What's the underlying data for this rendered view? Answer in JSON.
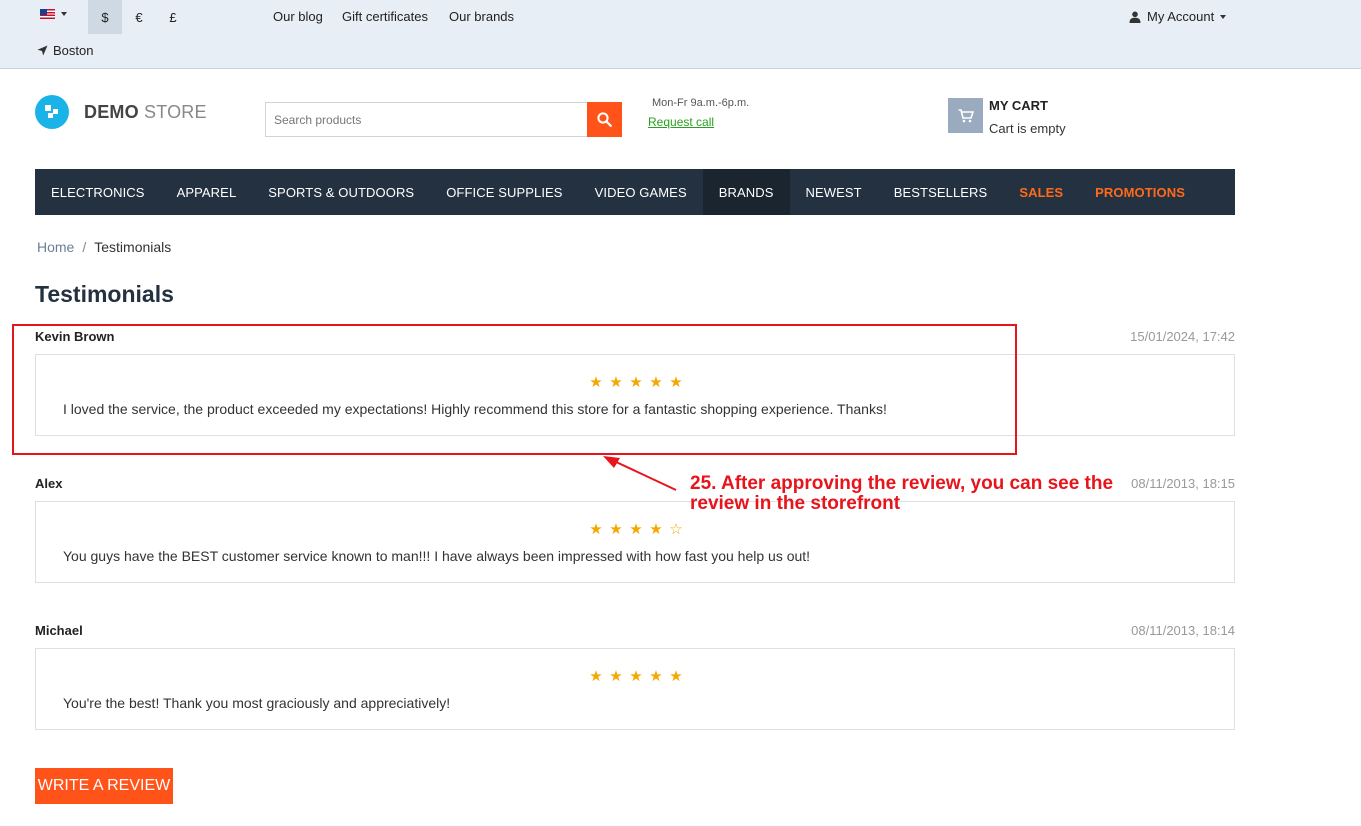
{
  "topbar": {
    "currencies": [
      "$",
      "€",
      "£"
    ],
    "active_currency": "$",
    "links": [
      "Our blog",
      "Gift certificates",
      "Our brands"
    ],
    "account_label": "My Account",
    "location": "Boston"
  },
  "header": {
    "logo_bold": "DEMO",
    "logo_thin": "STORE",
    "search_placeholder": "Search products",
    "hours": "Mon-Fr 9a.m.-6p.m.",
    "request_call": "Request call",
    "cart_title": "MY CART",
    "cart_status": "Cart is empty"
  },
  "nav": {
    "items": [
      "ELECTRONICS",
      "APPAREL",
      "SPORTS & OUTDOORS",
      "OFFICE SUPPLIES",
      "VIDEO GAMES",
      "BRANDS",
      "NEWEST",
      "BESTSELLERS",
      "SALES",
      "PROMOTIONS"
    ]
  },
  "breadcrumb": {
    "home": "Home",
    "separator": "/",
    "current": "Testimonials"
  },
  "page_title": "Testimonials",
  "reviews": [
    {
      "author": "Kevin Brown",
      "date": "15/01/2024, 17:42",
      "rating": 5,
      "text": "I loved the service, the product exceeded my expectations! Highly recommend this store for a fantastic shopping experience. Thanks!"
    },
    {
      "author": "Alex",
      "date": "08/11/2013, 18:15",
      "rating": 4,
      "text": "You guys have the BEST customer service known to man!!! I have always been impressed with how fast you help us out!"
    },
    {
      "author": "Michael",
      "date": "08/11/2013, 18:14",
      "rating": 5,
      "text": "You're the best! Thank you most graciously and appreciatively!"
    }
  ],
  "write_review_label": "WRITE A REVIEW",
  "annotation": {
    "line1": "25. After approving the review, you can see the",
    "line2": "review in the storefront",
    "color": "#e8141b"
  },
  "colors": {
    "accent": "#ff5319",
    "nav_bg": "#243140",
    "star": "#f5a800",
    "logo": "#1ab3e8"
  }
}
